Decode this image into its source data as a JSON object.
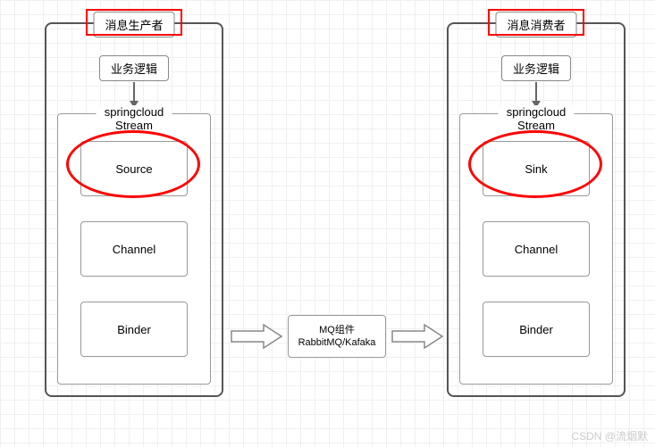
{
  "producer": {
    "title": "消息生产者",
    "logic": "业务逻辑",
    "stream_label": "springcloud Stream",
    "box1": "Source",
    "box2": "Channel",
    "box3": "Binder"
  },
  "consumer": {
    "title": "消息消费者",
    "logic": "业务逻辑",
    "stream_label": "springcloud Stream",
    "box1": "Sink",
    "box2": "Channel",
    "box3": "Binder"
  },
  "mq": {
    "line1": "MQ组件",
    "line2": "RabbitMQ/Kafaka"
  },
  "watermark": "CSDN @流烟默"
}
